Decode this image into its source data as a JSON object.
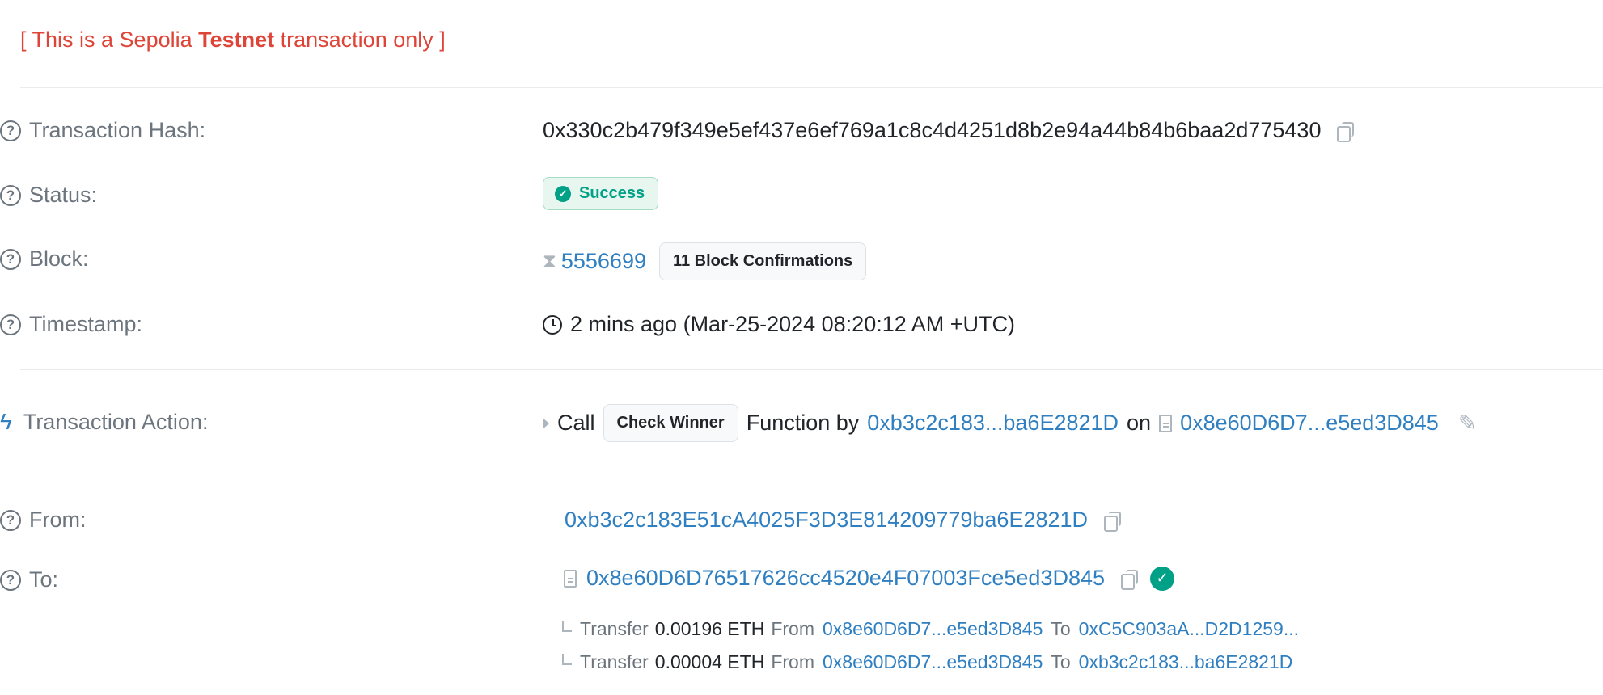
{
  "banner": {
    "prefix": "[ This is a Sepolia ",
    "bold": "Testnet",
    "suffix": " transaction only ]"
  },
  "rows": {
    "tx_hash": {
      "label": "Transaction Hash:",
      "value": "0x330c2b479f349e5ef437e6ef769a1c8c4d4251d8b2e94a44b84b6baa2d775430"
    },
    "status": {
      "label": "Status:",
      "value": "Success"
    },
    "block": {
      "label": "Block:",
      "number": "5556699",
      "confirmations": "11 Block Confirmations"
    },
    "timestamp": {
      "label": "Timestamp:",
      "value": "2 mins ago (Mar-25-2024 08:20:12 AM +UTC)"
    },
    "action": {
      "label": "Transaction Action:",
      "call": "Call",
      "function": "Check Winner",
      "by_text": "Function by",
      "from": "0xb3c2c183...ba6E2821D",
      "on_text": "on",
      "contract": "0x8e60D6D7...e5ed3D845"
    },
    "from": {
      "label": "From:",
      "value": "0xb3c2c183E51cA4025F3D3E814209779ba6E2821D"
    },
    "to": {
      "label": "To:",
      "value": "0x8e60D6D76517626cc4520e4F07003Fce5ed3D845"
    }
  },
  "transfers": [
    {
      "word": "Transfer",
      "amount": "0.00196 ETH",
      "from_word": "From",
      "from": "0x8e60D6D7...e5ed3D845",
      "to_word": "To",
      "to": "0xC5C903aA...D2D1259..."
    },
    {
      "word": "Transfer",
      "amount": "0.00004 ETH",
      "from_word": "From",
      "from": "0x8e60D6D7...e5ed3D845",
      "to_word": "To",
      "to": "0xb3c2c183...ba6E2821D"
    }
  ],
  "colors": {
    "link": "#2f7fc1",
    "success": "#00a186",
    "banner": "#de4437"
  }
}
